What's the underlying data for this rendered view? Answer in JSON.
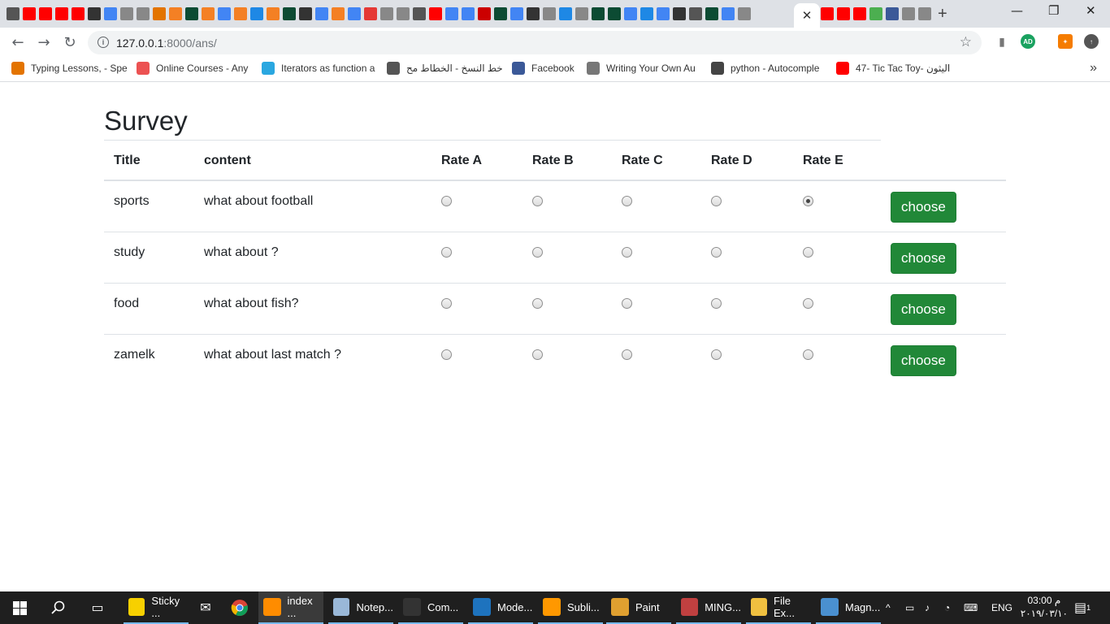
{
  "browser": {
    "active_tab_close": "✕",
    "new_tab": "+",
    "window_controls": [
      "—",
      "❐",
      "✕"
    ],
    "url_host": "127.0.0.1",
    "url_rest": ":8000/ans/",
    "extension_badge": "AD"
  },
  "bookmarks": [
    {
      "label": "Typing Lessons, - Spe",
      "icon": "typing-icon",
      "color": "#e37400"
    },
    {
      "label": "Online Courses - Any",
      "icon": "udemy-icon",
      "color": "#ec5252"
    },
    {
      "label": "Iterators as function a",
      "icon": "shield-icon",
      "color": "#2aa7e0"
    },
    {
      "label": "خط النسخ - الخطاط مح",
      "icon": "calligraphy-icon",
      "color": "#555555"
    },
    {
      "label": "Facebook",
      "icon": "facebook-icon",
      "color": "#3b5998"
    },
    {
      "label": "Writing Your Own Au",
      "icon": "document-icon",
      "color": "#777777"
    },
    {
      "label": "python - Autocomple",
      "icon": "globe-icon",
      "color": "#444444"
    },
    {
      "label": "47- Tic Tac Toy- اليثون",
      "icon": "youtube-icon",
      "color": "#ff0000"
    }
  ],
  "survey": {
    "title": "Survey",
    "columns": [
      "Title",
      "content",
      "Rate A",
      "Rate B",
      "Rate C",
      "Rate D",
      "Rate E"
    ],
    "rows": [
      {
        "title": "sports",
        "content": "what about football",
        "selected": 4,
        "button": "choose"
      },
      {
        "title": "study",
        "content": "what about ?",
        "selected": -1,
        "button": "choose"
      },
      {
        "title": "food",
        "content": "what about fish?",
        "selected": -1,
        "button": "choose"
      },
      {
        "title": "zamelk",
        "content": "what about last match ?",
        "selected": -1,
        "button": "choose"
      }
    ]
  },
  "taskbar": {
    "apps": [
      {
        "label": "Sticky ...",
        "icon": "sticky-notes-icon",
        "color": "#f7d000"
      },
      {
        "label": "index ...",
        "icon": "browser-icon",
        "color": "#ff8c00",
        "active": true
      },
      {
        "label": "Notep...",
        "icon": "notepad-icon",
        "color": "#9ab8d8"
      },
      {
        "label": "Com...",
        "icon": "terminal-icon",
        "color": "#333333"
      },
      {
        "label": "Mode...",
        "icon": "edge-icon",
        "color": "#1e73be"
      },
      {
        "label": "Subli...",
        "icon": "sublime-icon",
        "color": "#ff9800"
      },
      {
        "label": "Paint",
        "icon": "paint-icon",
        "color": "#e0a030"
      },
      {
        "label": "MING...",
        "icon": "git-icon",
        "color": "#c04040"
      },
      {
        "label": "File Ex...",
        "icon": "folder-icon",
        "color": "#f0c040"
      },
      {
        "label": "Magn...",
        "icon": "magnifier-icon",
        "color": "#4a90d0"
      }
    ],
    "language": "ENG",
    "time": "03:00 م",
    "date": "٢٠١٩/٠٣/١٠",
    "notifications": "1"
  }
}
